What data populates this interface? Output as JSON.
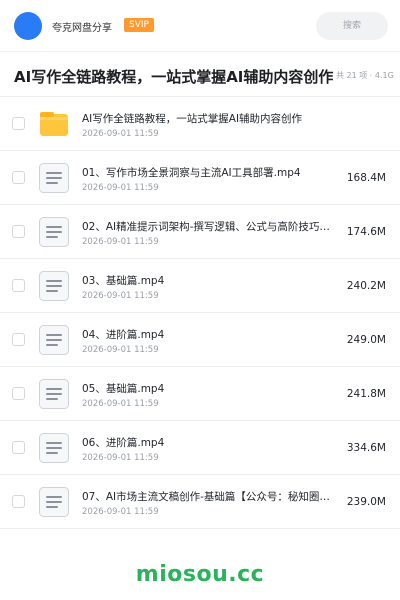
{
  "header": {
    "share_name": "夸克网盘分享",
    "badge": "SVIP",
    "search_placeholder": "搜索"
  },
  "title_bar": {
    "title": "AI写作全链路教程，一站式掌握AI辅助内容创作",
    "meta": "共 21 项 · 4.1G"
  },
  "files": [
    {
      "name": "AI写作全链路教程，一站式掌握AI辅助内容创作",
      "date": "2026-09-01 11:59",
      "size": "",
      "type": "folder"
    },
    {
      "name": "01、写作市场全景洞察与主流AI工具部署.mp4",
      "date": "2026-09-01 11:59",
      "size": "168.4M",
      "type": "file"
    },
    {
      "name": "02、AI精准提示词架构-撰写逻辑、公式与高阶技巧…",
      "date": "2026-09-01 11:59",
      "size": "174.6M",
      "type": "file"
    },
    {
      "name": "03、基础篇.mp4",
      "date": "2026-09-01 11:59",
      "size": "240.2M",
      "type": "file"
    },
    {
      "name": "04、进阶篇.mp4",
      "date": "2026-09-01 11:59",
      "size": "249.0M",
      "type": "file"
    },
    {
      "name": "05、基础篇.mp4",
      "date": "2026-09-01 11:59",
      "size": "241.8M",
      "type": "file"
    },
    {
      "name": "06、进阶篇.mp4",
      "date": "2026-09-01 11:59",
      "size": "334.6M",
      "type": "file"
    },
    {
      "name": "07、AI市场主流文稿创作-基础篇【公众号：秘知圈…",
      "date": "2026-09-01 11:59",
      "size": "239.0M",
      "type": "file"
    }
  ],
  "watermark": "miosou.cc",
  "colors": {
    "avatar": "#2a7cf6",
    "svip": "#ff9a2e",
    "folder": "#ffc53d",
    "watermark": "#29b35a"
  }
}
